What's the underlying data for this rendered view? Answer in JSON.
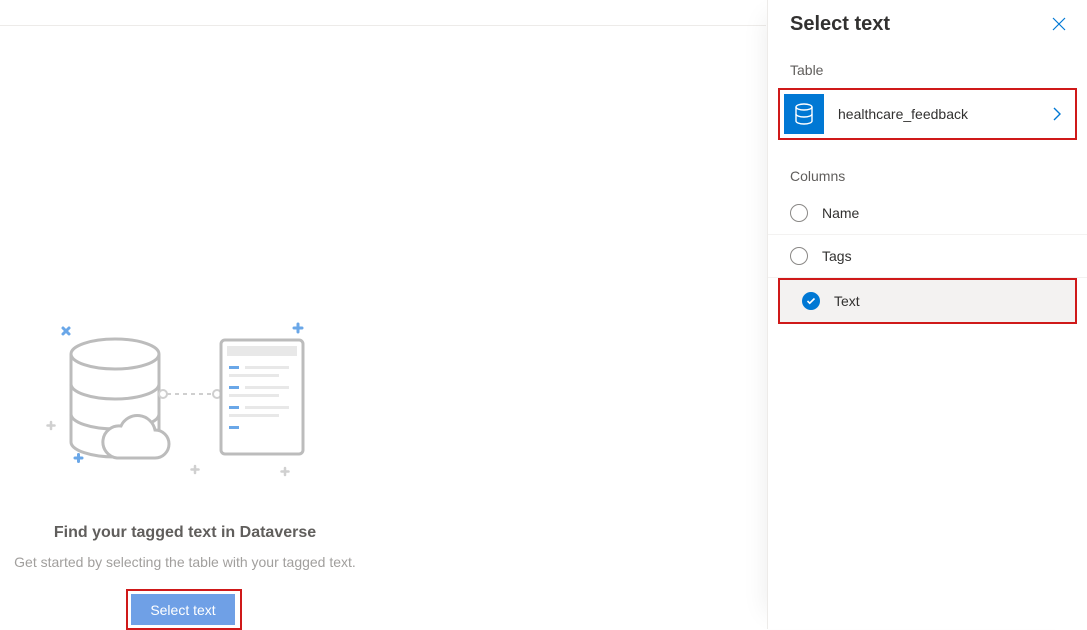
{
  "main": {
    "title": "Find your tagged text in Dataverse",
    "subtitle": "Get started by selecting the table with your tagged text.",
    "button_label": "Select text"
  },
  "panel": {
    "title": "Select text",
    "table_label": "Table",
    "table_name": "healthcare_feedback",
    "columns_label": "Columns",
    "columns": [
      {
        "label": "Name",
        "selected": false
      },
      {
        "label": "Tags",
        "selected": false
      },
      {
        "label": "Text",
        "selected": true
      }
    ]
  }
}
